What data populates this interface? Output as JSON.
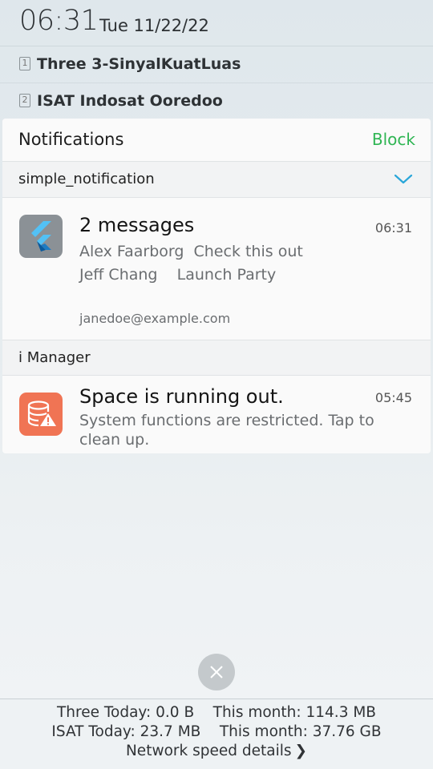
{
  "status": {
    "time": "06:31",
    "date": "Tue 11/22/22"
  },
  "sims": [
    {
      "slot": "1",
      "name": "Three 3-SinyalKuatLuas"
    },
    {
      "slot": "2",
      "name": "ISAT Indosat Ooredoo"
    }
  ],
  "panel": {
    "title": "Notifications",
    "block_label": "Block"
  },
  "groups": [
    {
      "name": "simple_notification",
      "notification": {
        "title": "2 messages",
        "time": "06:31",
        "lines": [
          "Alex Faarborg  Check this out",
          "Jeff Chang    Launch Party"
        ],
        "account": "janedoe@example.com",
        "icon": "flutter-icon"
      }
    },
    {
      "name": "i Manager",
      "notification": {
        "title": "Space is running out.",
        "time": "05:45",
        "body": "System functions are restricted. Tap to clean up.",
        "icon": "storage-warning-icon"
      }
    }
  ],
  "footer": {
    "usage_three": "Three Today: 0.0 B    This month: 114.3 MB",
    "usage_isat": "ISAT Today: 23.7 MB    This month: 37.76 GB",
    "network_link": "Network speed details"
  },
  "colors": {
    "block": "#2fb553",
    "chevron": "#29a6d9",
    "imanager_icon": "#f07454",
    "flutter_icon_bg": "#8b9196"
  }
}
